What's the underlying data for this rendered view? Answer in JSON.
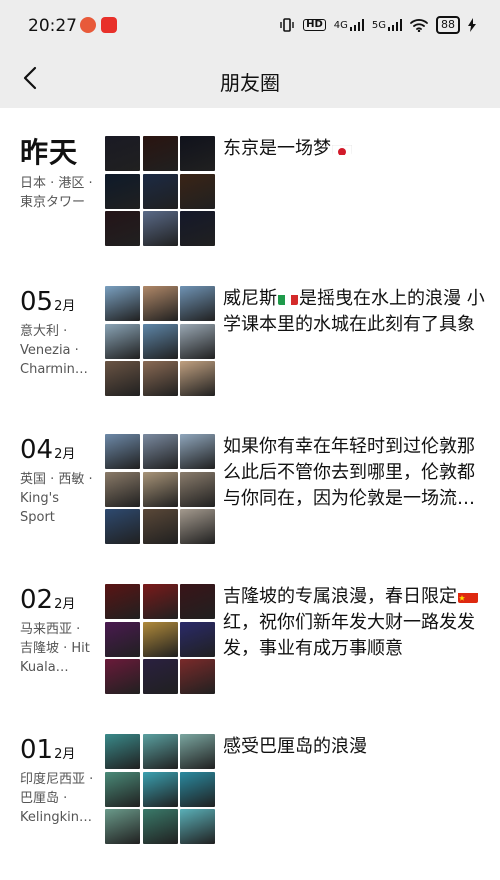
{
  "status_bar": {
    "time": "20:27",
    "hd": "HD",
    "net1": "4G",
    "net2": "5G",
    "battery": "88"
  },
  "header": {
    "title": "朋友圈"
  },
  "icons": {
    "back": "back-chevron-icon",
    "flags": [
      "japan-flag-icon",
      "italy-flag-icon",
      "china-flag-icon"
    ]
  },
  "colors": {
    "header_bg": "#ededed",
    "location_text": "#555555"
  },
  "entries": [
    {
      "date_label": "昨天",
      "location": "日本 · 港区 · 東京タワー",
      "text_before": "东京是一场梦",
      "text_after": "",
      "flag": "japan",
      "tiles": [
        "#1a1a24",
        "#2a1410",
        "#10121c",
        "#0e1a2a",
        "#1c2a44",
        "#3a2416",
        "#241418",
        "#5a6a88",
        "#14182a"
      ]
    },
    {
      "day": "05",
      "month": "2月",
      "location": "意大利 · Venezia · Charming Venice",
      "text_before": "威尼斯",
      "text_after": "是摇曳在水上的浪漫 小学课本里的水城在此刻有了具象",
      "flag": "italy",
      "tiles": [
        "#7aa0c0",
        "#b08868",
        "#6f93b4",
        "#8aa4b6",
        "#5e86a8",
        "#9aa8b4",
        "#6a5444",
        "#8a6a54",
        "#c0a080"
      ]
    },
    {
      "day": "04",
      "month": "2月",
      "location": "英国 · 西敏 · King's Sport",
      "text_before": "如果你有幸在年轻时到过伦敦那么此后不管你去到哪里，伦敦都与你同在，因为伦敦是一场流动的盛宴",
      "text_after": "",
      "flag": "",
      "tiles": [
        "#6d89a8",
        "#7a8aa0",
        "#8fa6bc",
        "#8a7a68",
        "#a89478",
        "#8a7c6c",
        "#2e4a70",
        "#5a4838",
        "#a49a8e"
      ]
    },
    {
      "day": "02",
      "month": "2月",
      "location": "马来西亚 · 吉隆坡 · Hit Kuala Lumpur",
      "text_before": "吉隆坡的专属浪漫，春日限定",
      "text_after": "红，祝你们新年发大财一路发发发，事业有成万事顺意",
      "flag": "china",
      "tiles": [
        "#5a1414",
        "#7a1a1a",
        "#3a1418",
        "#4a1a50",
        "#b08a3a",
        "#2a2a6a",
        "#6a1a3a",
        "#2a2040",
        "#7a2a2a"
      ]
    },
    {
      "day": "01",
      "month": "2月",
      "location": "印度尼西亚 · 巴厘岛 · Kelingking Beach",
      "text_before": "感受巴厘岛的浪漫",
      "text_after": "",
      "flag": "",
      "tiles": [
        "#3a8a8a",
        "#5aa0a0",
        "#7aa6a0",
        "#4a8a78",
        "#3aa0b0",
        "#2a8aa0",
        "#6a9a8a",
        "#3a7a6a",
        "#5ab0b8"
      ]
    }
  ]
}
